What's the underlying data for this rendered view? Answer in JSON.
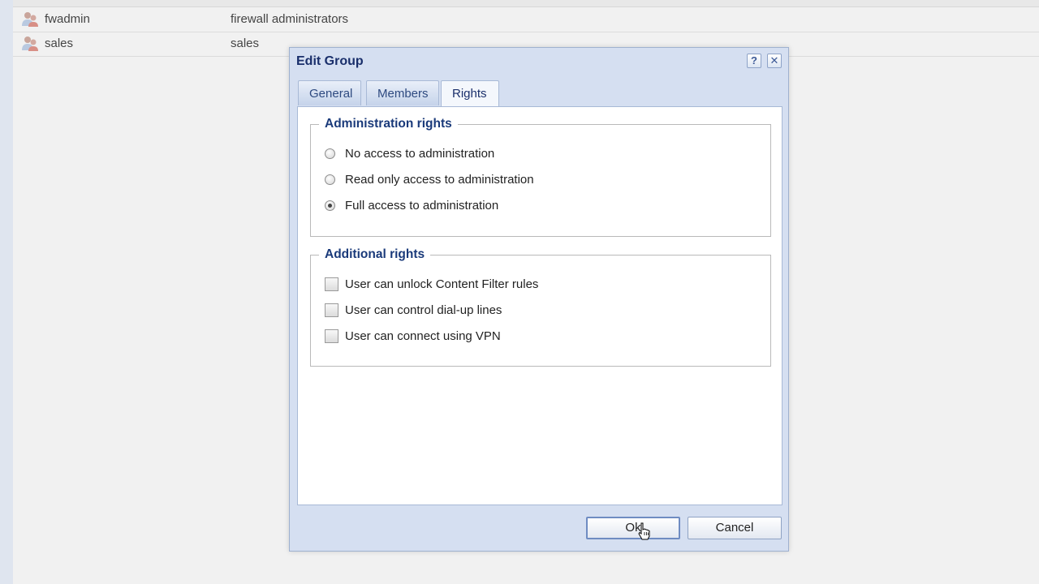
{
  "background_list": {
    "rows": [
      {
        "name": "fwadmin",
        "description": "firewall administrators",
        "icon": "group-icon"
      },
      {
        "name": "sales",
        "description": "sales",
        "icon": "group-icon"
      }
    ]
  },
  "dialog": {
    "title": "Edit Group",
    "help_button": "?",
    "close_button": "✕",
    "tabs": [
      {
        "label": "General",
        "active": false
      },
      {
        "label": "Members",
        "active": false
      },
      {
        "label": "Rights",
        "active": true
      }
    ],
    "administration_rights": {
      "legend": "Administration rights",
      "options": [
        {
          "label": "No access to administration",
          "checked": false
        },
        {
          "label": "Read only access to administration",
          "checked": false
        },
        {
          "label": "Full access to administration",
          "checked": true
        }
      ]
    },
    "additional_rights": {
      "legend": "Additional rights",
      "options": [
        {
          "label": "User can unlock Content Filter rules",
          "checked": false
        },
        {
          "label": "User can control dial-up lines",
          "checked": false
        },
        {
          "label": "User can connect using VPN",
          "checked": false
        }
      ]
    },
    "ok_label": "Ok",
    "cancel_label": "Cancel"
  },
  "colors": {
    "dialog_bg": "#d5dff1",
    "title_text": "#1a2f6b",
    "legend_text": "#1a3a7a"
  }
}
